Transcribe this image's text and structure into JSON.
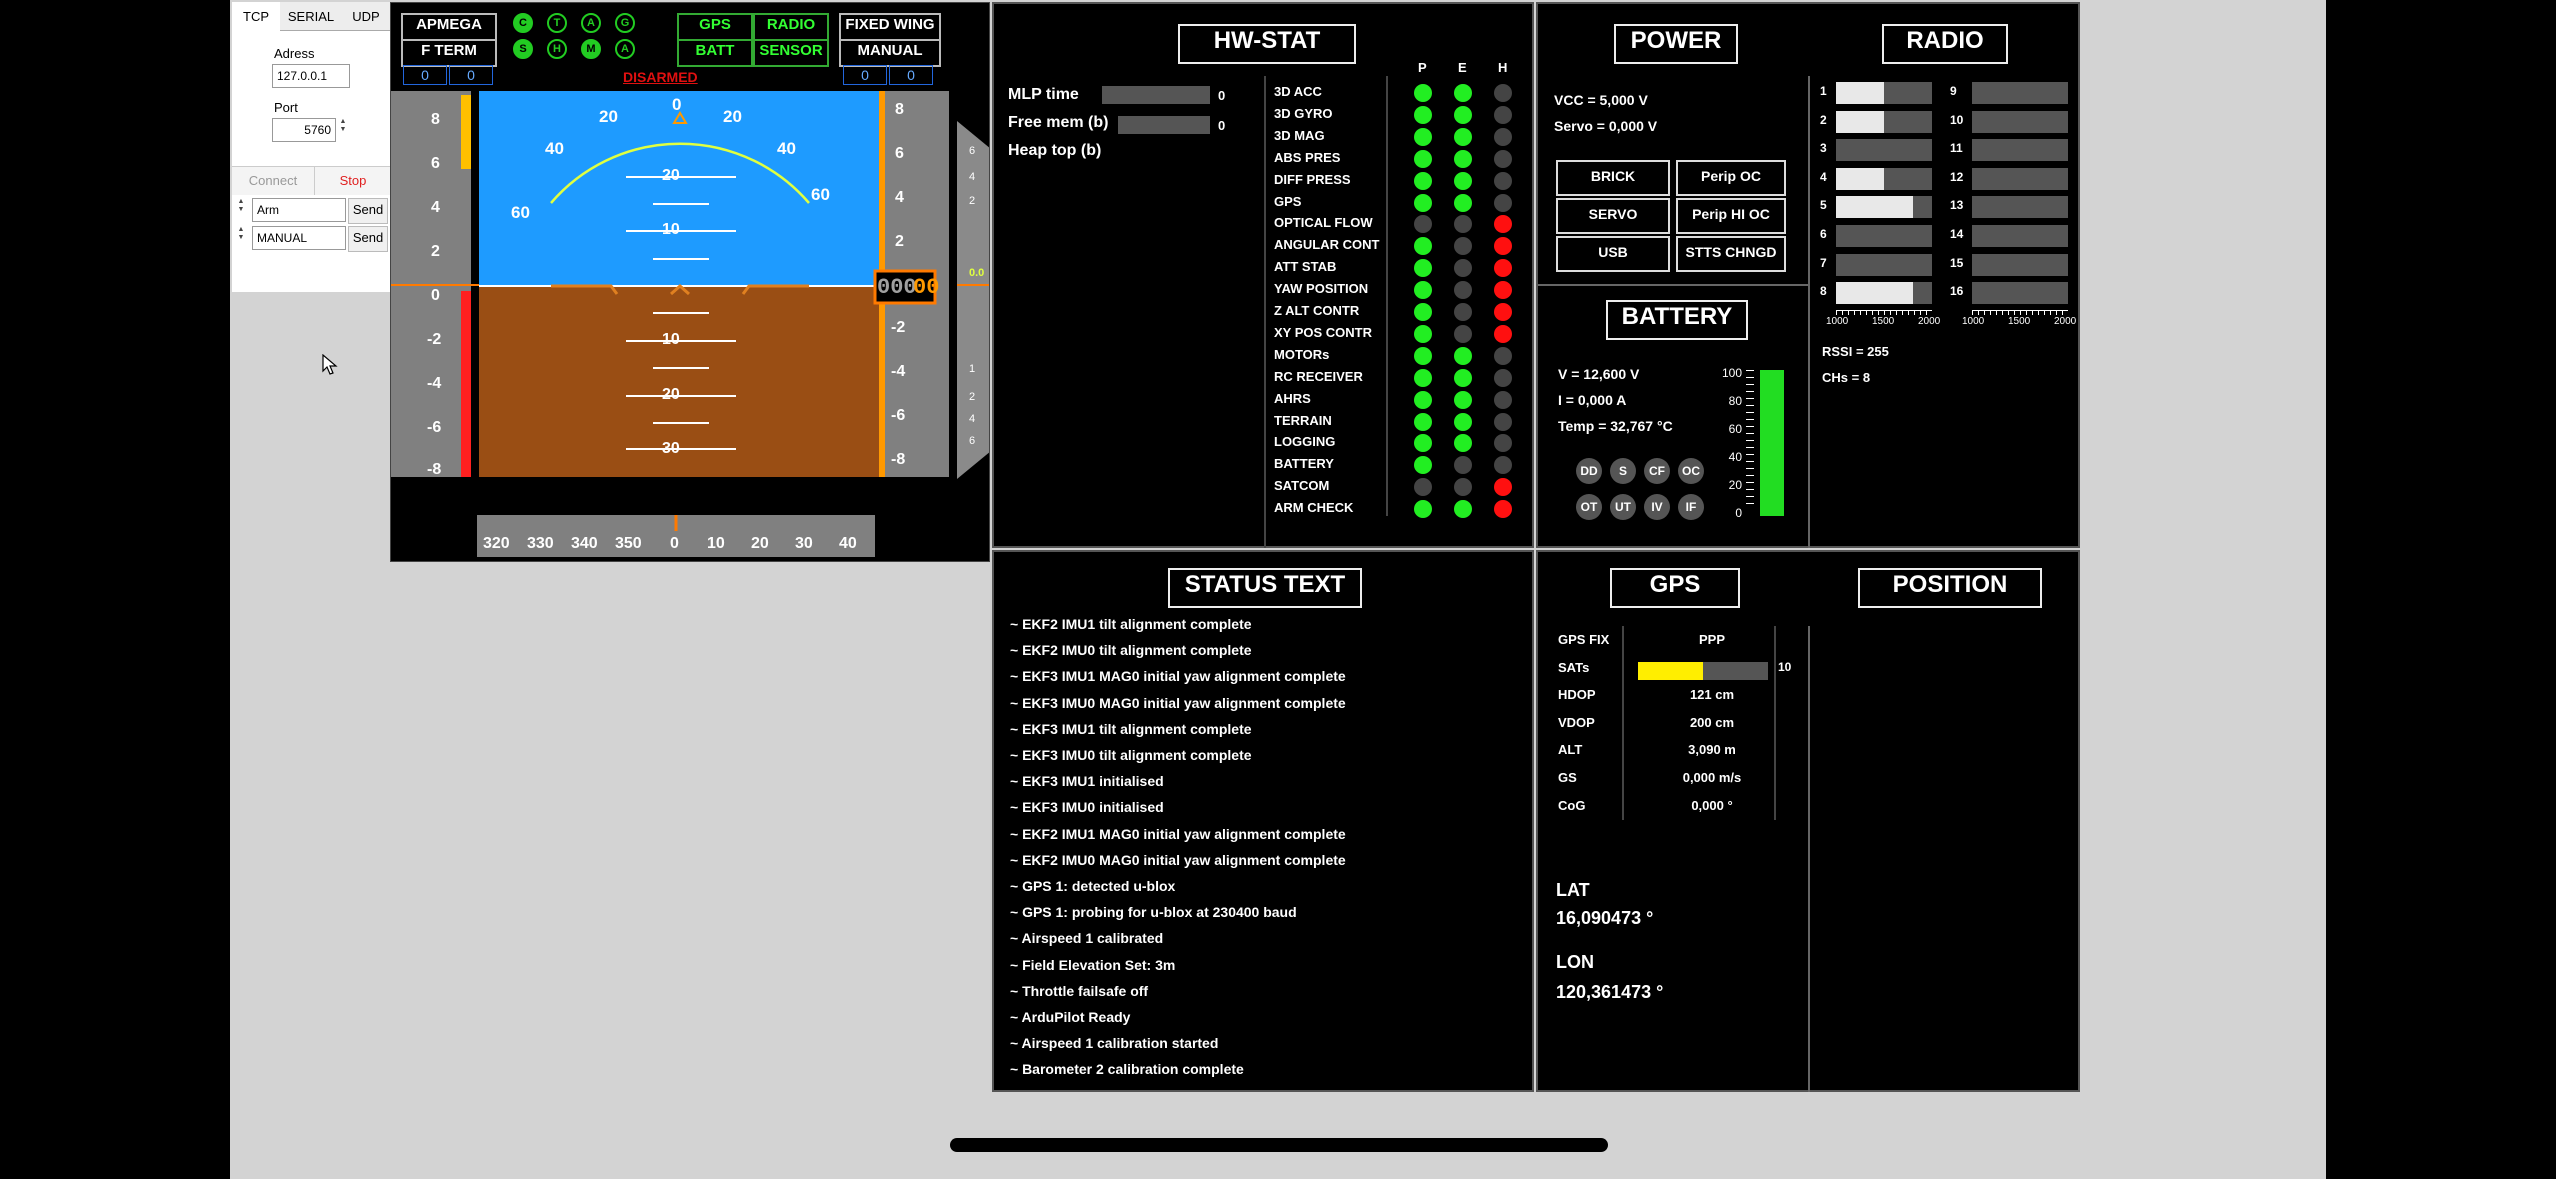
{
  "connection": {
    "tabs": [
      "TCP",
      "SERIAL",
      "UDP"
    ],
    "address_label": "Adress",
    "address_value": "127.0.0.1",
    "port_label": "Port",
    "port_value": "5760",
    "connect_label": "Connect",
    "stop_label": "Stop",
    "commands": [
      {
        "value": "Arm",
        "send": "Send"
      },
      {
        "value": "MANUAL",
        "send": "Send"
      }
    ]
  },
  "hud": {
    "left_buttons": [
      "APMEGA",
      "F TERM"
    ],
    "left_values": [
      "0",
      "0"
    ],
    "circles_row1": [
      "C",
      "T",
      "A",
      "G"
    ],
    "circles_row2": [
      "S",
      "H",
      "M",
      "A"
    ],
    "status_buttons": [
      "GPS",
      "RADIO",
      "BATT",
      "SENSOR"
    ],
    "right_buttons": [
      "FIXED WING",
      "MANUAL"
    ],
    "right_values": [
      "0",
      "0"
    ],
    "armed_text": "DISARMED",
    "roll_labels": [
      "60",
      "40",
      "20",
      "0",
      "20",
      "40",
      "60"
    ],
    "pitch_up": [
      "20",
      "10"
    ],
    "pitch_down": [
      "10",
      "20",
      "30"
    ],
    "left_tape": [
      "8",
      "6",
      "4",
      "2",
      "0",
      "-2",
      "-4",
      "-6",
      "-8"
    ],
    "right_tape": [
      "8",
      "6",
      "4",
      "2",
      "0",
      "-2",
      "-4",
      "-6",
      "-8"
    ],
    "altitude_readout_dim": "000",
    "altitude_readout": "00",
    "vsi_value": "0.0",
    "vsi_labels": [
      "6",
      "4",
      "2",
      "1",
      "2",
      "4",
      "6"
    ],
    "heading_labels": [
      "320",
      "330",
      "340",
      "350",
      "0",
      "10",
      "20",
      "30",
      "40"
    ],
    "colors": {
      "sky": "#1e9bff",
      "ground": "#9a4e14",
      "accent": "#ff7a00",
      "warn": "#ff2020",
      "yellow": "#ffc000"
    }
  },
  "hwstat": {
    "title": "HW-STAT",
    "metrics": [
      {
        "label": "MLP time",
        "value": "0"
      },
      {
        "label": "Free mem (b)",
        "value": "0"
      },
      {
        "label": "Heap top (b)",
        "value": ""
      }
    ],
    "columns": [
      "P",
      "E",
      "H"
    ],
    "sensors": [
      {
        "name": "3D ACC",
        "p": "g",
        "e": "g",
        "h": "k"
      },
      {
        "name": "3D GYRO",
        "p": "g",
        "e": "g",
        "h": "k"
      },
      {
        "name": "3D MAG",
        "p": "g",
        "e": "g",
        "h": "k"
      },
      {
        "name": "ABS PRES",
        "p": "g",
        "e": "g",
        "h": "k"
      },
      {
        "name": "DIFF PRESS",
        "p": "g",
        "e": "g",
        "h": "k"
      },
      {
        "name": "GPS",
        "p": "g",
        "e": "g",
        "h": "k"
      },
      {
        "name": "OPTICAL FLOW",
        "p": "k",
        "e": "k",
        "h": "r"
      },
      {
        "name": "ANGULAR CONT",
        "p": "g",
        "e": "k",
        "h": "r"
      },
      {
        "name": "ATT STAB",
        "p": "g",
        "e": "k",
        "h": "r"
      },
      {
        "name": "YAW POSITION",
        "p": "g",
        "e": "k",
        "h": "r"
      },
      {
        "name": "Z ALT CONTR",
        "p": "g",
        "e": "k",
        "h": "r"
      },
      {
        "name": "XY POS CONTR",
        "p": "g",
        "e": "k",
        "h": "r"
      },
      {
        "name": "MOTORs",
        "p": "g",
        "e": "g",
        "h": "k"
      },
      {
        "name": "RC RECEIVER",
        "p": "g",
        "e": "g",
        "h": "k"
      },
      {
        "name": "AHRS",
        "p": "g",
        "e": "g",
        "h": "k"
      },
      {
        "name": "TERRAIN",
        "p": "g",
        "e": "g",
        "h": "k"
      },
      {
        "name": "LOGGING",
        "p": "g",
        "e": "g",
        "h": "k"
      },
      {
        "name": "BATTERY",
        "p": "g",
        "e": "k",
        "h": "k"
      },
      {
        "name": "SATCOM",
        "p": "k",
        "e": "k",
        "h": "r"
      },
      {
        "name": "ARM CHECK",
        "p": "g",
        "e": "g",
        "h": "r"
      }
    ]
  },
  "power": {
    "title": "POWER",
    "vcc": "VCC = 5,000 V",
    "servo": "Servo = 0,000 V",
    "buttons": [
      "BRICK",
      "Perip OC",
      "SERVO",
      "Perip HI OC",
      "USB",
      "STTS CHNGD"
    ]
  },
  "radio": {
    "title": "RADIO",
    "channels_left": [
      {
        "ch": "1",
        "fill": 0.5
      },
      {
        "ch": "2",
        "fill": 0.5
      },
      {
        "ch": "3",
        "fill": 0.0
      },
      {
        "ch": "4",
        "fill": 0.5
      },
      {
        "ch": "5",
        "fill": 0.8
      },
      {
        "ch": "6",
        "fill": 0.0
      },
      {
        "ch": "7",
        "fill": 0.0
      },
      {
        "ch": "8",
        "fill": 0.8
      }
    ],
    "channels_right": [
      {
        "ch": "9",
        "fill": 0.0
      },
      {
        "ch": "10",
        "fill": 0.0
      },
      {
        "ch": "11",
        "fill": 0.0
      },
      {
        "ch": "12",
        "fill": 0.0
      },
      {
        "ch": "13",
        "fill": 0.0
      },
      {
        "ch": "14",
        "fill": 0.0
      },
      {
        "ch": "15",
        "fill": 0.0
      },
      {
        "ch": "16",
        "fill": 0.0
      }
    ],
    "scale": [
      "1000",
      "1500",
      "2000"
    ],
    "rssi": "RSSI = 255",
    "chs": "CHs = 8"
  },
  "battery": {
    "title": "BATTERY",
    "voltage": "V = 12,600 V",
    "current": "I = 0,000 A",
    "temp": "Temp = 32,767 °C",
    "flags_row1": [
      "DD",
      "S",
      "CF",
      "OC"
    ],
    "flags_row2": [
      "OT",
      "UT",
      "IV",
      "IF"
    ],
    "gauge_labels": [
      "100",
      "80",
      "60",
      "40",
      "20",
      "0"
    ],
    "gauge_level": 1.0
  },
  "status_text": {
    "title": "STATUS TEXT",
    "lines": [
      "~ EKF2 IMU1 tilt alignment complete",
      "~ EKF2 IMU0 tilt alignment complete",
      "~ EKF3 IMU1 MAG0 initial yaw alignment complete",
      "~ EKF3 IMU0 MAG0 initial yaw alignment complete",
      "~ EKF3 IMU1 tilt alignment complete",
      "~ EKF3 IMU0 tilt alignment complete",
      "~ EKF3 IMU1 initialised",
      "~ EKF3 IMU0 initialised",
      "~ EKF2 IMU1 MAG0 initial yaw alignment complete",
      "~ EKF2 IMU0 MAG0 initial yaw alignment complete",
      "~ GPS 1: detected u-blox",
      "~ GPS 1: probing for u-blox at 230400 baud",
      "~ Airspeed 1 calibrated",
      "~ Field Elevation Set: 3m",
      "~ Throttle failsafe off",
      "~ ArduPilot Ready",
      "~ Airspeed 1 calibration started",
      "~ Barometer 2 calibration complete"
    ]
  },
  "gps": {
    "title": "GPS",
    "rows": [
      {
        "label": "GPS FIX",
        "value": "PPP"
      },
      {
        "label": "SATs",
        "value": "10"
      },
      {
        "label": "HDOP",
        "value": "121 cm"
      },
      {
        "label": "VDOP",
        "value": "200 cm"
      },
      {
        "label": "ALT",
        "value": "3,090 m"
      },
      {
        "label": "GS",
        "value": "0,000 m/s"
      },
      {
        "label": "CoG",
        "value": "0,000 °"
      }
    ],
    "sats_fill": 0.5,
    "lat_label": "LAT",
    "lat_value": "16,090473 °",
    "lon_label": "LON",
    "lon_value": "120,361473 °"
  },
  "position": {
    "title": "POSITION"
  }
}
